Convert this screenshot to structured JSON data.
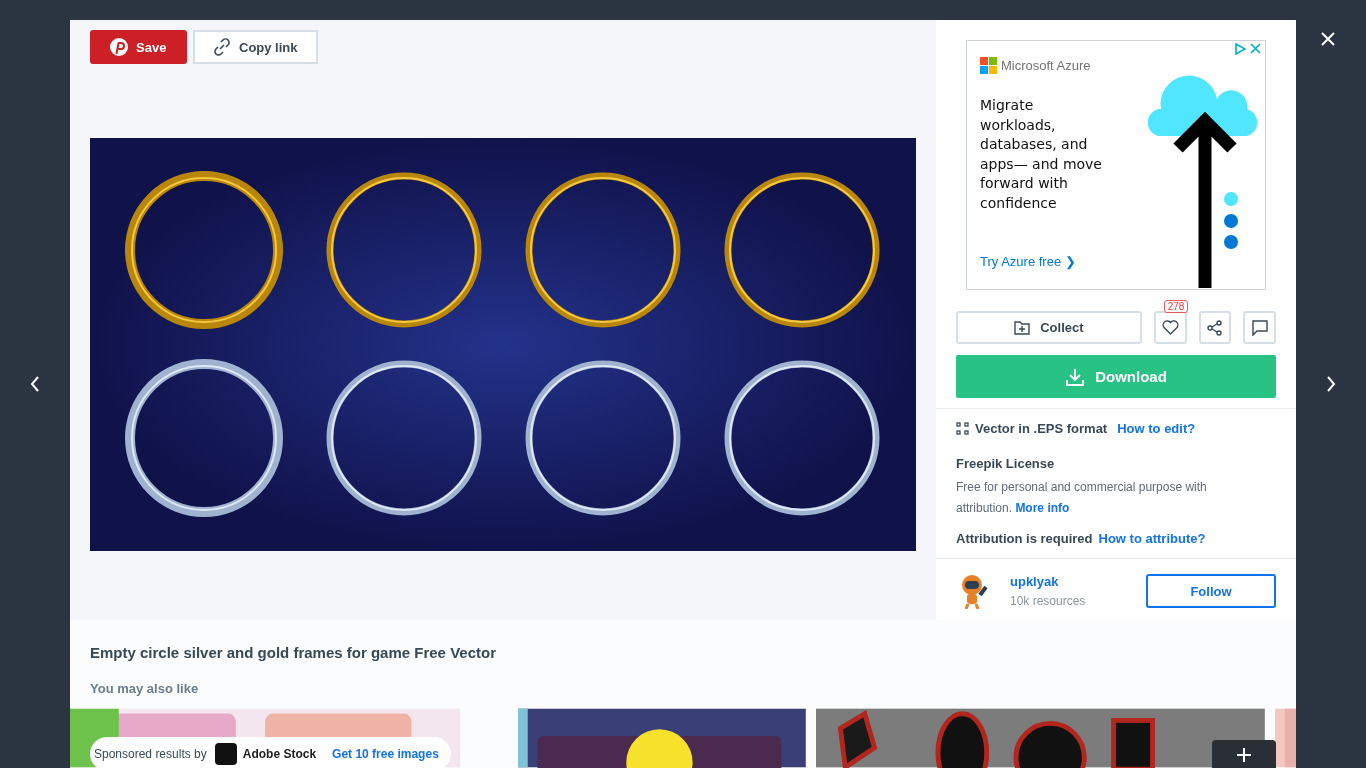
{
  "toolbar": {
    "save": "Save",
    "copy_link": "Copy link"
  },
  "ad": {
    "brand": "Microsoft Azure",
    "headline": "Migrate workloads, databases, and apps— and move forward with confidence",
    "cta": "Try Azure free ❯"
  },
  "actions": {
    "collect": "Collect",
    "likes": "278",
    "download": "Download"
  },
  "file_info": {
    "format": "Vector in .EPS format",
    "link": "How to edit?"
  },
  "license": {
    "title": "Freepik License",
    "text": "Free for personal and commercial purpose with attribution.",
    "link": "More info",
    "attribution": "Attribution is required",
    "attribution_link": "How to attribute?"
  },
  "author": {
    "name": "upklyak",
    "resources": "10k resources",
    "follow": "Follow"
  },
  "title": "Empty circle silver and gold frames for game Free Vector",
  "related": {
    "heading": "You may also like",
    "sponsored": {
      "label": "Sponsored results by",
      "brand": "Adobe Stock",
      "link": "Get 10 free images"
    }
  }
}
